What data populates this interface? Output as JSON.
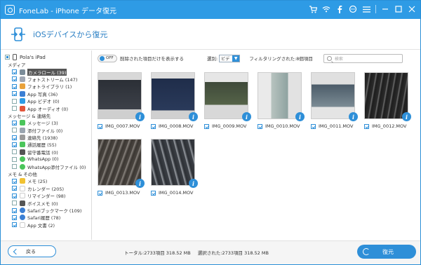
{
  "app": {
    "title": "FoneLab - iPhone データ復元"
  },
  "header": {
    "title": "iOSデバイスから復元"
  },
  "sidebar": {
    "device": "Pola's iPad",
    "groups": [
      {
        "label": "メディア",
        "items": [
          {
            "label": "カメラロール (39)",
            "color": "#7b8c99",
            "selected": true
          },
          {
            "label": "フォトストリーム (147)",
            "color": "#a0a7b4"
          },
          {
            "label": "フォトライブラリ (1)",
            "color": "#e9a23b"
          },
          {
            "label": "App 写真 (36)",
            "color": "#3b7fd4"
          },
          {
            "label": "App ビデオ (0)",
            "color": "#2e9be5"
          },
          {
            "label": "App オーディオ (0)",
            "color": "#e2553a"
          }
        ]
      },
      {
        "label": "メッセージ & 連絡先",
        "items": [
          {
            "label": "メッセージ (3)",
            "color": "#4bc55b"
          },
          {
            "label": "添付ファイル (0)",
            "color": "#9aa5b0"
          },
          {
            "label": "連絡先 (1938)",
            "color": "#9a9a9a"
          },
          {
            "label": "通話履歴 (55)",
            "color": "#4bc55b"
          },
          {
            "label": "留守番電話 (0)",
            "color": "#555555"
          },
          {
            "label": "WhatsApp (0)",
            "color": "#4bc55b"
          },
          {
            "label": "WhatsApp添付ファイル (0)",
            "color": "#4bc55b"
          }
        ]
      },
      {
        "label": "メモ & その他",
        "items": [
          {
            "label": "メモ (25)",
            "color": "#f1c232"
          },
          {
            "label": "カレンダー (205)",
            "color": "#ffffff"
          },
          {
            "label": "リマインダー (98)",
            "color": "#ffffff"
          },
          {
            "label": "ボイスメモ (0)",
            "color": "#555555"
          },
          {
            "label": "Safariブックマーク (109)",
            "color": "#3b7fd4"
          },
          {
            "label": "Safari履歴 (78)",
            "color": "#3b7fd4"
          },
          {
            "label": "App 文書 (2)",
            "color": "#ffffff"
          }
        ]
      }
    ]
  },
  "toolbar": {
    "toggle_state": "OFF",
    "toggle_label": "削除された項目だけを表示する",
    "sort_label": "選別:",
    "sort_value": "ビデ",
    "filter_text": "フィルタリングされた:8個項目",
    "search_placeholder": "検索"
  },
  "files": [
    {
      "name": "IMG_0007.MOV"
    },
    {
      "name": "IMG_0008.MOV"
    },
    {
      "name": "IMG_0009.MOV"
    },
    {
      "name": "IMG_0010.MOV"
    },
    {
      "name": "IMG_0011.MOV"
    },
    {
      "name": "IMG_0012.MOV"
    },
    {
      "name": "IMG_0013.MOV"
    },
    {
      "name": "IMG_0014.MOV"
    }
  ],
  "footer": {
    "back_label": "戻る",
    "total": "トータル:2733項目 318.52 MB",
    "selected": "選択された:2733項目 318.52 MB",
    "restore_label": "復元"
  },
  "colors": {
    "accent": "#2e8fd8",
    "titlebar": "#2e9be5"
  }
}
